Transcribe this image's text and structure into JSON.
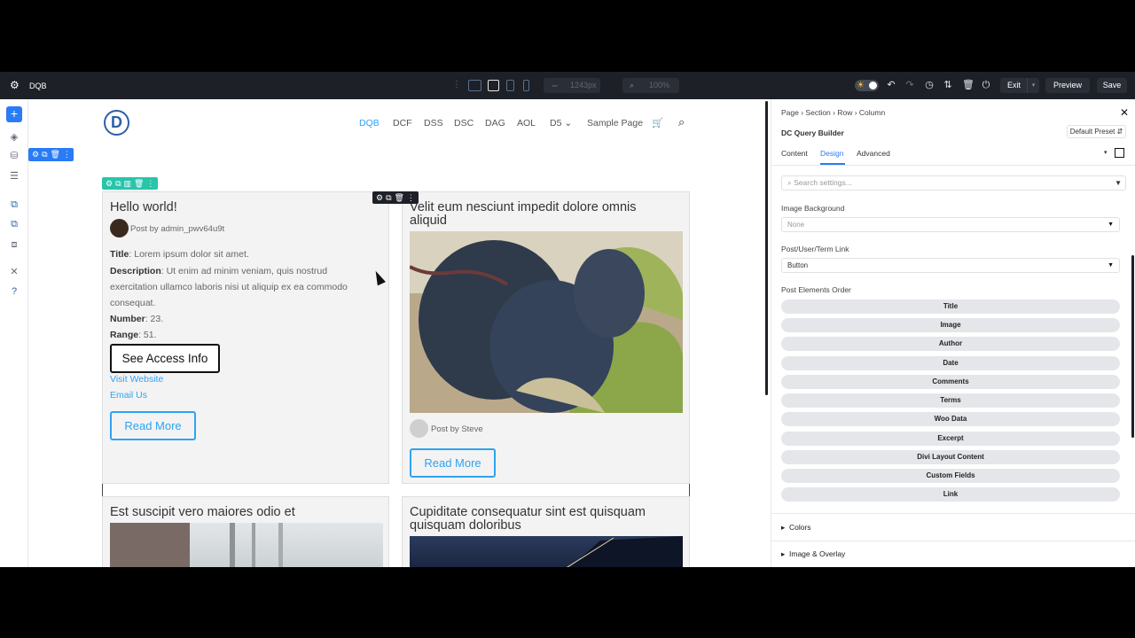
{
  "app": {
    "name": "DQB"
  },
  "toolbar": {
    "width_value": "1243px",
    "zoom_value": "100%",
    "exit_label": "Exit",
    "preview_label": "Preview",
    "save_label": "Save"
  },
  "nav": {
    "items": [
      "DQB",
      "DCF",
      "DSS",
      "DSC",
      "DAG",
      "AOL",
      "D5 ⌄",
      "Sample Page"
    ],
    "active_index": 0
  },
  "posts": [
    {
      "title": "Hello world!",
      "author": "Post by admin_pwv64u9t",
      "fields": [
        {
          "label": "Title",
          "value": ": Lorem ipsum dolor sit amet."
        },
        {
          "label": "Description",
          "value": ": Ut enim ad minim veniam, quis nostrud"
        },
        {
          "label": "",
          "value": "exercitation ullamco laboris nisi ut aliquip ex ea commodo"
        },
        {
          "label": "",
          "value": "consequat."
        },
        {
          "label": "Number",
          "value": ": 23."
        },
        {
          "label": "Range",
          "value": ": 51."
        }
      ],
      "button_label": "See Access Info",
      "links": [
        "Visit Website",
        "Email Us"
      ],
      "read_more": "Read More"
    },
    {
      "title_line1": "Velit eum nesciunt impedit dolore omnis",
      "title_line2": "aliquid",
      "author": "Post by Steve",
      "read_more": "Read More"
    },
    {
      "title": "Est suscipit vero maiores odio et"
    },
    {
      "title_line1": "Cupiditate consequatur sint est quisquam",
      "title_line2": "quisquam doloribus"
    }
  ],
  "panel": {
    "breadcrumb": [
      "Page",
      "Section",
      "Row",
      "Column"
    ],
    "module_title": "DC Query Builder",
    "preset_label": "Default Preset ⇵",
    "tabs": [
      "Content",
      "Design",
      "Advanced"
    ],
    "active_tab": "Design",
    "search_placeholder": "Search settings...",
    "image_background": {
      "label": "Image Background",
      "value": "None"
    },
    "post_link": {
      "label": "Post/User/Term Link",
      "value": "Button"
    },
    "elements_order_label": "Post Elements Order",
    "elements_order": [
      "Title",
      "Image",
      "Author",
      "Date",
      "Comments",
      "Terms",
      "Woo Data",
      "Excerpt",
      "Divi Layout Content",
      "Custom Fields",
      "Link"
    ],
    "groups": [
      "Colors",
      "Image & Overlay"
    ]
  }
}
